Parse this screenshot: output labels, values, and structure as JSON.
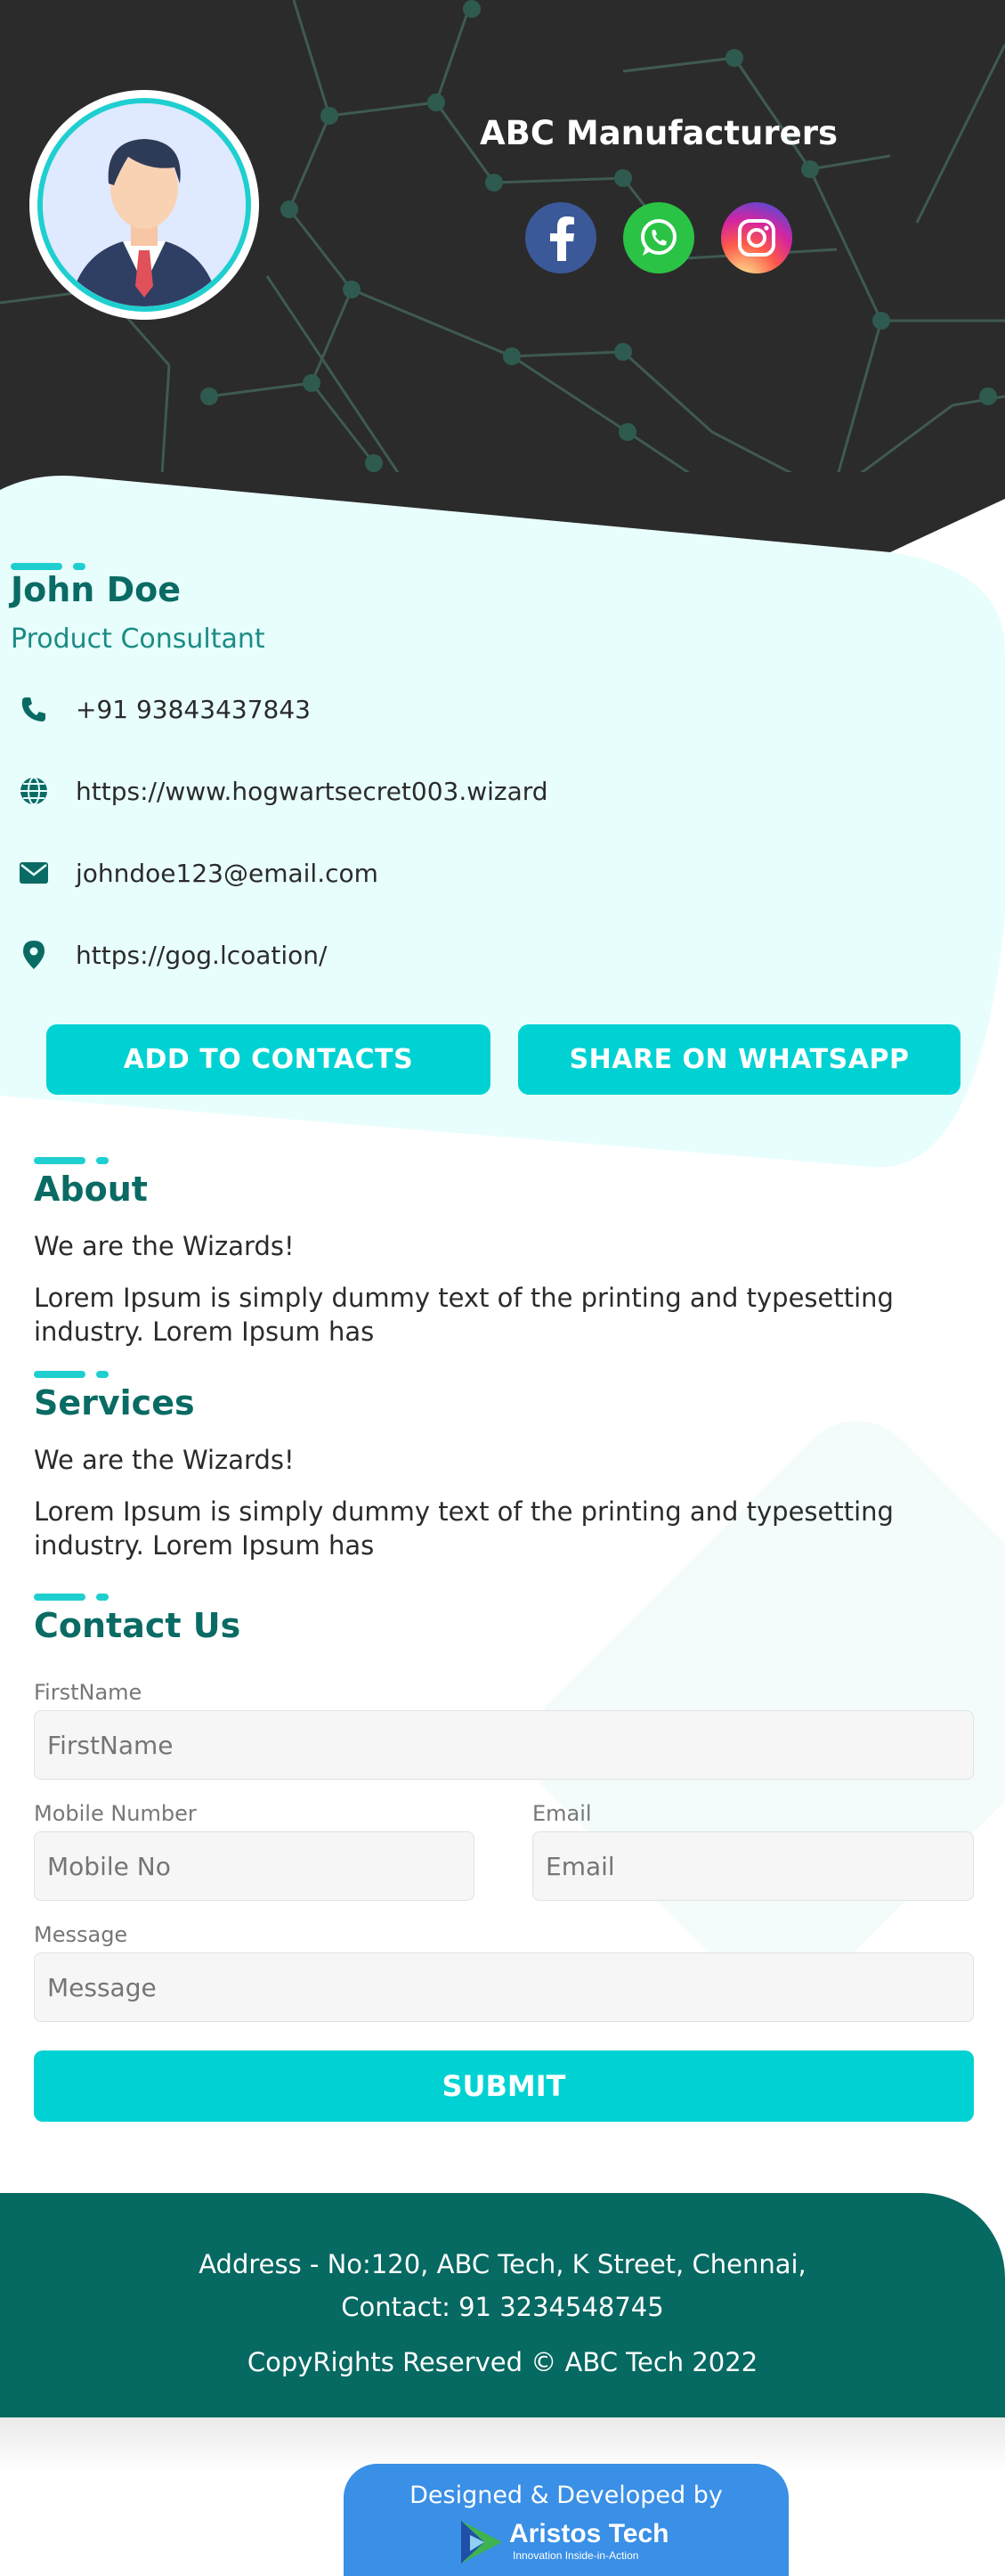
{
  "header": {
    "company_name": "ABC Manufacturers",
    "social": [
      {
        "name": "facebook-icon",
        "color": "#3b5998"
      },
      {
        "name": "whatsapp-icon",
        "color": "#2bc346"
      },
      {
        "name": "instagram-icon",
        "color": "#d6249f"
      }
    ]
  },
  "profile": {
    "name": "John Doe",
    "title": "Product Consultant",
    "phone": "+91 93843437843",
    "website": "https://www.hogwartsecret003.wizard",
    "email": "johndoe123@email.com",
    "location": "https://gog.lcoation/"
  },
  "actions": {
    "add_contacts": "ADD TO CONTACTS",
    "share_whatsapp": "SHARE ON WHATSAPP"
  },
  "about": {
    "title": "About",
    "tagline": "We are the Wizards!",
    "body": "Lorem Ipsum is simply dummy text of the printing and typesetting industry. Lorem Ipsum has"
  },
  "services": {
    "title": "Services",
    "tagline": "We are the Wizards!",
    "body": "Lorem Ipsum is simply dummy text of the printing and typesetting industry. Lorem Ipsum has"
  },
  "contact": {
    "title": "Contact Us",
    "firstname_label": "FirstName",
    "firstname_placeholder": "FirstName",
    "mobile_label": "Mobile Number",
    "mobile_placeholder": "Mobile No",
    "email_label": "Email",
    "email_placeholder": "Email",
    "message_label": "Message",
    "message_placeholder": "Message",
    "submit": "SUBMIT"
  },
  "footer": {
    "address": "Address - No:120, ABC Tech, K Street, Chennai,",
    "contact": "Contact: 91 3234548745",
    "copyright": "CopyRights Reserved © ABC Tech 2022"
  },
  "credit": {
    "designed_by": "Designed & Developed by",
    "brand": "Aristos Tech",
    "tagline": "Innovation Inside-in-Action"
  },
  "colors": {
    "accent": "#00d2d3",
    "primary_dark": "#0a6b64",
    "header_bg": "#2b2b2b",
    "footer_bg": "#066962"
  }
}
